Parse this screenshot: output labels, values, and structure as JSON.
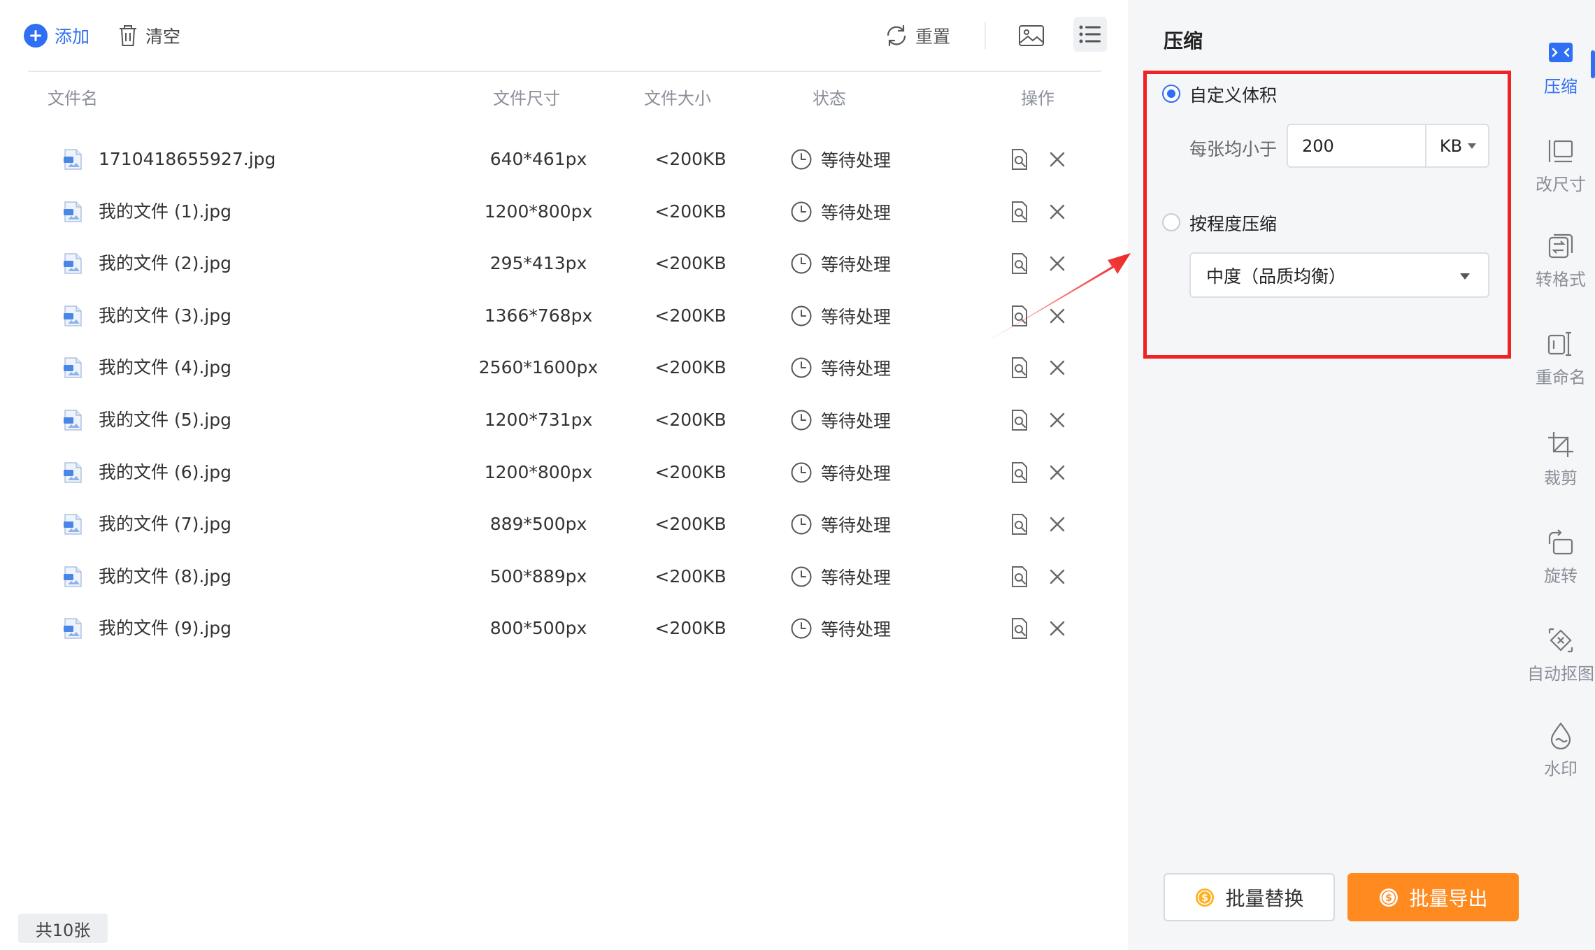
{
  "toolbar": {
    "add_label": "添加",
    "clear_label": "清空",
    "reset_label": "重置"
  },
  "table": {
    "headers": {
      "name": "文件名",
      "dimensions": "文件尺寸",
      "size": "文件大小",
      "status": "状态",
      "actions": "操作"
    },
    "rows": [
      {
        "name": "1710418655927.jpg",
        "dimensions": "640*461px",
        "size": "<200KB",
        "status": "等待处理"
      },
      {
        "name": "我的文件 (1).jpg",
        "dimensions": "1200*800px",
        "size": "<200KB",
        "status": "等待处理"
      },
      {
        "name": "我的文件 (2).jpg",
        "dimensions": "295*413px",
        "size": "<200KB",
        "status": "等待处理"
      },
      {
        "name": "我的文件 (3).jpg",
        "dimensions": "1366*768px",
        "size": "<200KB",
        "status": "等待处理"
      },
      {
        "name": "我的文件 (4).jpg",
        "dimensions": "2560*1600px",
        "size": "<200KB",
        "status": "等待处理"
      },
      {
        "name": "我的文件 (5).jpg",
        "dimensions": "1200*731px",
        "size": "<200KB",
        "status": "等待处理"
      },
      {
        "name": "我的文件 (6).jpg",
        "dimensions": "1200*800px",
        "size": "<200KB",
        "status": "等待处理"
      },
      {
        "name": "我的文件 (7).jpg",
        "dimensions": "889*500px",
        "size": "<200KB",
        "status": "等待处理"
      },
      {
        "name": "我的文件 (8).jpg",
        "dimensions": "500*889px",
        "size": "<200KB",
        "status": "等待处理"
      },
      {
        "name": "我的文件 (9).jpg",
        "dimensions": "800*500px",
        "size": "<200KB",
        "status": "等待处理"
      }
    ]
  },
  "footer": {
    "count_label": "共10张"
  },
  "panel": {
    "title": "压缩",
    "custom_size_label": "自定义体积",
    "each_less_than_label": "每张均小于",
    "size_value": "200",
    "size_unit": "KB",
    "by_level_label": "按程度压缩",
    "level_value": "中度（品质均衡）",
    "selected_option": "custom_size",
    "batch_replace_label": "批量替换",
    "batch_export_label": "批量导出"
  },
  "rail": {
    "items": [
      {
        "label": "压缩",
        "icon": "compress-icon",
        "active": true
      },
      {
        "label": "改尺寸",
        "icon": "resize-icon",
        "active": false
      },
      {
        "label": "转格式",
        "icon": "convert-format-icon",
        "active": false
      },
      {
        "label": "重命名",
        "icon": "rename-icon",
        "active": false
      },
      {
        "label": "裁剪",
        "icon": "crop-icon",
        "active": false
      },
      {
        "label": "旋转",
        "icon": "rotate-icon",
        "active": false
      },
      {
        "label": "自动抠图",
        "icon": "auto-cutout-icon",
        "active": false
      },
      {
        "label": "水印",
        "icon": "watermark-icon",
        "active": false
      }
    ]
  },
  "colors": {
    "accent": "#2f6ff3",
    "export_button": "#ff8a1f",
    "highlight_border": "#ee2424",
    "panel_background": "#f5f6f8"
  }
}
